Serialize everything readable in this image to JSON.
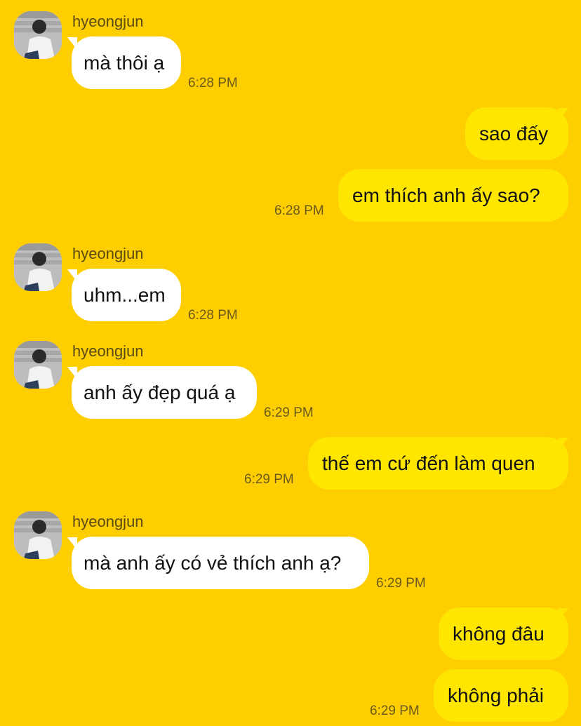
{
  "contact": {
    "name": "hyeongjun",
    "avatar_icon": "profile-photo"
  },
  "colors": {
    "background": "#FFCE00",
    "incoming_bubble": "#FFFFFF",
    "outgoing_bubble": "#FFE600"
  },
  "messages": [
    {
      "direction": "in",
      "text": "mà thôi ạ",
      "time": "6:28 PM"
    },
    {
      "direction": "out",
      "text": "sao đấy",
      "time": ""
    },
    {
      "direction": "out",
      "text": "em thích anh ấy sao?",
      "time": "6:28 PM"
    },
    {
      "direction": "in",
      "text": "uhm...em",
      "time": "6:28 PM"
    },
    {
      "direction": "in",
      "text": "anh ấy đẹp quá ạ",
      "time": "6:29 PM"
    },
    {
      "direction": "out",
      "text": "thế em cứ đến làm quen",
      "time": "6:29 PM"
    },
    {
      "direction": "in",
      "text": "mà anh ấy có vẻ thích anh ạ?",
      "time": "6:29 PM"
    },
    {
      "direction": "out",
      "text": "không đâu",
      "time": ""
    },
    {
      "direction": "out",
      "text": "không phải",
      "time": "6:29 PM"
    }
  ]
}
